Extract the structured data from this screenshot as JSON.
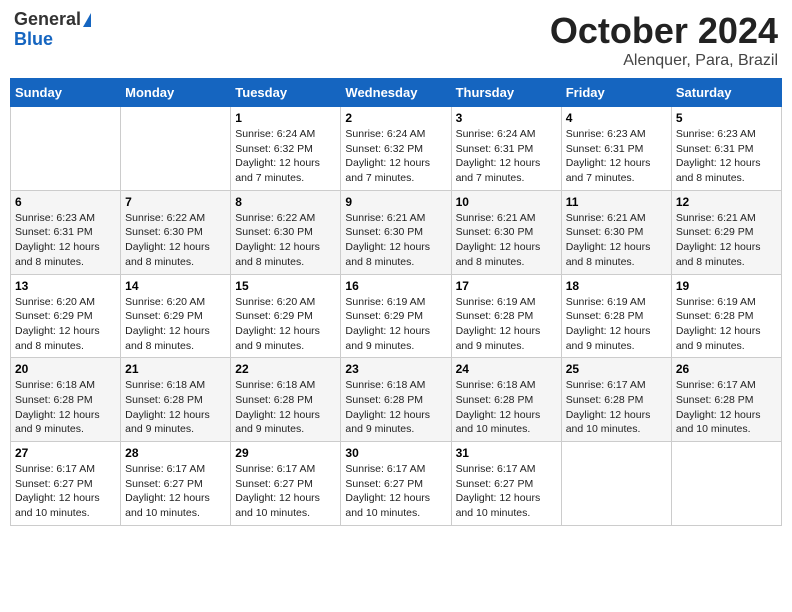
{
  "header": {
    "logo_general": "General",
    "logo_blue": "Blue",
    "month": "October 2024",
    "location": "Alenquer, Para, Brazil"
  },
  "days_of_week": [
    "Sunday",
    "Monday",
    "Tuesday",
    "Wednesday",
    "Thursday",
    "Friday",
    "Saturday"
  ],
  "weeks": [
    [
      {
        "day": "",
        "sunrise": "",
        "sunset": "",
        "daylight": ""
      },
      {
        "day": "",
        "sunrise": "",
        "sunset": "",
        "daylight": ""
      },
      {
        "day": "1",
        "sunrise": "Sunrise: 6:24 AM",
        "sunset": "Sunset: 6:32 PM",
        "daylight": "Daylight: 12 hours and 7 minutes."
      },
      {
        "day": "2",
        "sunrise": "Sunrise: 6:24 AM",
        "sunset": "Sunset: 6:32 PM",
        "daylight": "Daylight: 12 hours and 7 minutes."
      },
      {
        "day": "3",
        "sunrise": "Sunrise: 6:24 AM",
        "sunset": "Sunset: 6:31 PM",
        "daylight": "Daylight: 12 hours and 7 minutes."
      },
      {
        "day": "4",
        "sunrise": "Sunrise: 6:23 AM",
        "sunset": "Sunset: 6:31 PM",
        "daylight": "Daylight: 12 hours and 7 minutes."
      },
      {
        "day": "5",
        "sunrise": "Sunrise: 6:23 AM",
        "sunset": "Sunset: 6:31 PM",
        "daylight": "Daylight: 12 hours and 8 minutes."
      }
    ],
    [
      {
        "day": "6",
        "sunrise": "Sunrise: 6:23 AM",
        "sunset": "Sunset: 6:31 PM",
        "daylight": "Daylight: 12 hours and 8 minutes."
      },
      {
        "day": "7",
        "sunrise": "Sunrise: 6:22 AM",
        "sunset": "Sunset: 6:30 PM",
        "daylight": "Daylight: 12 hours and 8 minutes."
      },
      {
        "day": "8",
        "sunrise": "Sunrise: 6:22 AM",
        "sunset": "Sunset: 6:30 PM",
        "daylight": "Daylight: 12 hours and 8 minutes."
      },
      {
        "day": "9",
        "sunrise": "Sunrise: 6:21 AM",
        "sunset": "Sunset: 6:30 PM",
        "daylight": "Daylight: 12 hours and 8 minutes."
      },
      {
        "day": "10",
        "sunrise": "Sunrise: 6:21 AM",
        "sunset": "Sunset: 6:30 PM",
        "daylight": "Daylight: 12 hours and 8 minutes."
      },
      {
        "day": "11",
        "sunrise": "Sunrise: 6:21 AM",
        "sunset": "Sunset: 6:30 PM",
        "daylight": "Daylight: 12 hours and 8 minutes."
      },
      {
        "day": "12",
        "sunrise": "Sunrise: 6:21 AM",
        "sunset": "Sunset: 6:29 PM",
        "daylight": "Daylight: 12 hours and 8 minutes."
      }
    ],
    [
      {
        "day": "13",
        "sunrise": "Sunrise: 6:20 AM",
        "sunset": "Sunset: 6:29 PM",
        "daylight": "Daylight: 12 hours and 8 minutes."
      },
      {
        "day": "14",
        "sunrise": "Sunrise: 6:20 AM",
        "sunset": "Sunset: 6:29 PM",
        "daylight": "Daylight: 12 hours and 8 minutes."
      },
      {
        "day": "15",
        "sunrise": "Sunrise: 6:20 AM",
        "sunset": "Sunset: 6:29 PM",
        "daylight": "Daylight: 12 hours and 9 minutes."
      },
      {
        "day": "16",
        "sunrise": "Sunrise: 6:19 AM",
        "sunset": "Sunset: 6:29 PM",
        "daylight": "Daylight: 12 hours and 9 minutes."
      },
      {
        "day": "17",
        "sunrise": "Sunrise: 6:19 AM",
        "sunset": "Sunset: 6:28 PM",
        "daylight": "Daylight: 12 hours and 9 minutes."
      },
      {
        "day": "18",
        "sunrise": "Sunrise: 6:19 AM",
        "sunset": "Sunset: 6:28 PM",
        "daylight": "Daylight: 12 hours and 9 minutes."
      },
      {
        "day": "19",
        "sunrise": "Sunrise: 6:19 AM",
        "sunset": "Sunset: 6:28 PM",
        "daylight": "Daylight: 12 hours and 9 minutes."
      }
    ],
    [
      {
        "day": "20",
        "sunrise": "Sunrise: 6:18 AM",
        "sunset": "Sunset: 6:28 PM",
        "daylight": "Daylight: 12 hours and 9 minutes."
      },
      {
        "day": "21",
        "sunrise": "Sunrise: 6:18 AM",
        "sunset": "Sunset: 6:28 PM",
        "daylight": "Daylight: 12 hours and 9 minutes."
      },
      {
        "day": "22",
        "sunrise": "Sunrise: 6:18 AM",
        "sunset": "Sunset: 6:28 PM",
        "daylight": "Daylight: 12 hours and 9 minutes."
      },
      {
        "day": "23",
        "sunrise": "Sunrise: 6:18 AM",
        "sunset": "Sunset: 6:28 PM",
        "daylight": "Daylight: 12 hours and 9 minutes."
      },
      {
        "day": "24",
        "sunrise": "Sunrise: 6:18 AM",
        "sunset": "Sunset: 6:28 PM",
        "daylight": "Daylight: 12 hours and 10 minutes."
      },
      {
        "day": "25",
        "sunrise": "Sunrise: 6:17 AM",
        "sunset": "Sunset: 6:28 PM",
        "daylight": "Daylight: 12 hours and 10 minutes."
      },
      {
        "day": "26",
        "sunrise": "Sunrise: 6:17 AM",
        "sunset": "Sunset: 6:28 PM",
        "daylight": "Daylight: 12 hours and 10 minutes."
      }
    ],
    [
      {
        "day": "27",
        "sunrise": "Sunrise: 6:17 AM",
        "sunset": "Sunset: 6:27 PM",
        "daylight": "Daylight: 12 hours and 10 minutes."
      },
      {
        "day": "28",
        "sunrise": "Sunrise: 6:17 AM",
        "sunset": "Sunset: 6:27 PM",
        "daylight": "Daylight: 12 hours and 10 minutes."
      },
      {
        "day": "29",
        "sunrise": "Sunrise: 6:17 AM",
        "sunset": "Sunset: 6:27 PM",
        "daylight": "Daylight: 12 hours and 10 minutes."
      },
      {
        "day": "30",
        "sunrise": "Sunrise: 6:17 AM",
        "sunset": "Sunset: 6:27 PM",
        "daylight": "Daylight: 12 hours and 10 minutes."
      },
      {
        "day": "31",
        "sunrise": "Sunrise: 6:17 AM",
        "sunset": "Sunset: 6:27 PM",
        "daylight": "Daylight: 12 hours and 10 minutes."
      },
      {
        "day": "",
        "sunrise": "",
        "sunset": "",
        "daylight": ""
      },
      {
        "day": "",
        "sunrise": "",
        "sunset": "",
        "daylight": ""
      }
    ]
  ]
}
